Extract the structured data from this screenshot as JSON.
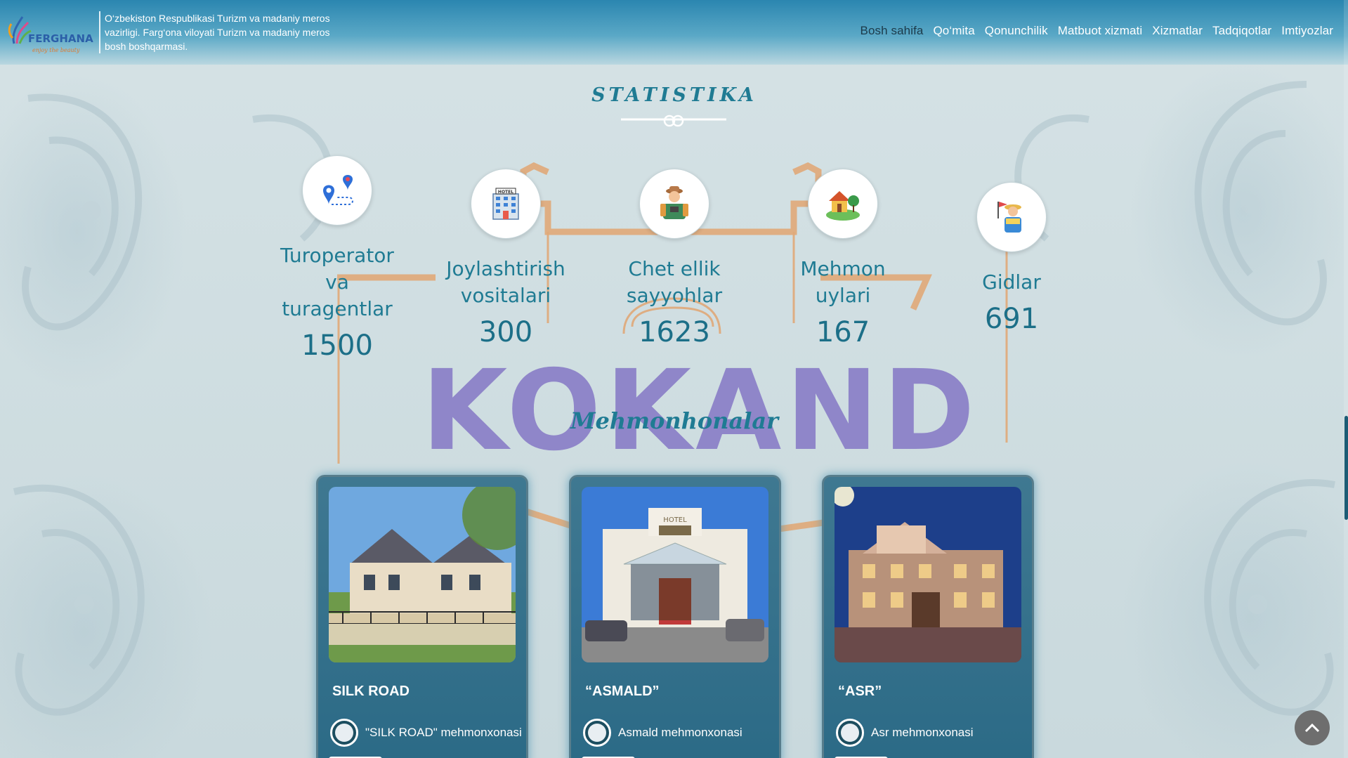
{
  "header": {
    "logo_text": "FERGHANA",
    "logo_tagline": "enjoy the beauty",
    "org_name": "O‘zbekiston Respublikasi Turizm va madaniy meros vazirligi. Farg‘ona viloyati Turizm va madaniy meros bosh boshqarmasi.",
    "nav": [
      {
        "label": "Bosh sahifa",
        "active": true
      },
      {
        "label": "Qo‘mita"
      },
      {
        "label": "Qonunchilik"
      },
      {
        "label": "Matbuot xizmati"
      },
      {
        "label": "Xizmatlar"
      },
      {
        "label": "Tadqiqotlar"
      },
      {
        "label": "Imtiyozlar"
      }
    ]
  },
  "stats": {
    "title": "STATISTIKA",
    "items": [
      {
        "icon": "map-route-icon",
        "label_lines": [
          "Turoperator",
          "va",
          "turagentlar"
        ],
        "value": "1500"
      },
      {
        "icon": "hotel-icon",
        "label_lines": [
          "Joylashtirish",
          "vositalari"
        ],
        "value": "300"
      },
      {
        "icon": "tourist-icon",
        "label_lines": [
          "Chet ellik",
          "sayyohlar"
        ],
        "value": "1623"
      },
      {
        "icon": "house-icon",
        "label_lines": [
          "Mehmon",
          "uylari"
        ],
        "value": "167"
      },
      {
        "icon": "guide-icon",
        "label_lines": [
          "Gidlar"
        ],
        "value": "691"
      }
    ]
  },
  "city": "KOKAND",
  "section_title": "Mehmonhonalar",
  "hotels": [
    {
      "name": "SILK ROAD",
      "subtitle": "\"SILK ROAD\" mehmonxonasi"
    },
    {
      "name": "“ASMALD”",
      "subtitle": "Asmald mehmonxonasi"
    },
    {
      "name": "“ASR”",
      "subtitle": "Asr mehmonxonasi"
    }
  ],
  "colors": {
    "accent": "#1f7b93",
    "city_text": "#8f86c9",
    "connector": "#e0a878",
    "header": "#2b86b0"
  }
}
